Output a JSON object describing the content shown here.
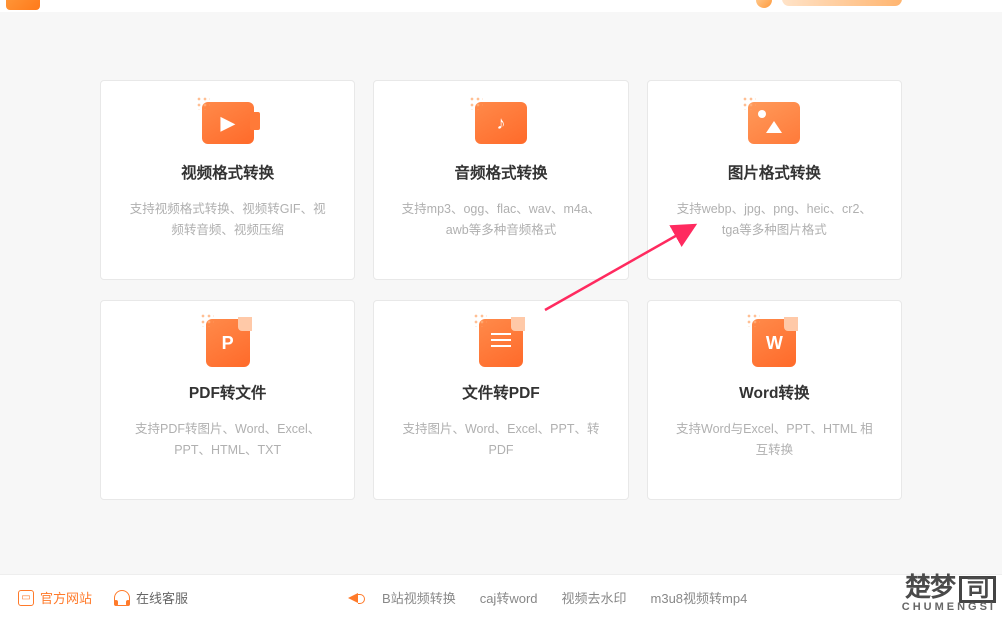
{
  "cards": [
    {
      "title": "视频格式转换",
      "desc": "支持视频格式转换、视频转GIF、视频转音频、视频压缩",
      "icon": "video-convert-icon",
      "sym": "▶"
    },
    {
      "title": "音频格式转换",
      "desc": "支持mp3、ogg、flac、wav、m4a、awb等多种音频格式",
      "icon": "audio-convert-icon",
      "sym": "♪"
    },
    {
      "title": "图片格式转换",
      "desc": "支持webp、jpg、png、heic、cr2、tga等多种图片格式",
      "icon": "image-convert-icon",
      "sym": ""
    },
    {
      "title": "PDF转文件",
      "desc": "支持PDF转图片、Word、Excel、PPT、HTML、TXT",
      "icon": "pdf-to-file-icon",
      "sym": "P"
    },
    {
      "title": "文件转PDF",
      "desc": "支持图片、Word、Excel、PPT、转PDF",
      "icon": "file-to-pdf-icon",
      "sym": ""
    },
    {
      "title": "Word转换",
      "desc": "支持Word与Excel、PPT、HTML 相互转换",
      "icon": "word-convert-icon",
      "sym": "W"
    }
  ],
  "footer": {
    "site": "官方网站",
    "support": "在线客服",
    "links": [
      "B站视频转换",
      "caj转word",
      "视频去水印",
      "m3u8视频转mp4"
    ]
  },
  "watermark": {
    "main": "楚梦",
    "box": "司",
    "sub": "CHUMENGSI"
  }
}
